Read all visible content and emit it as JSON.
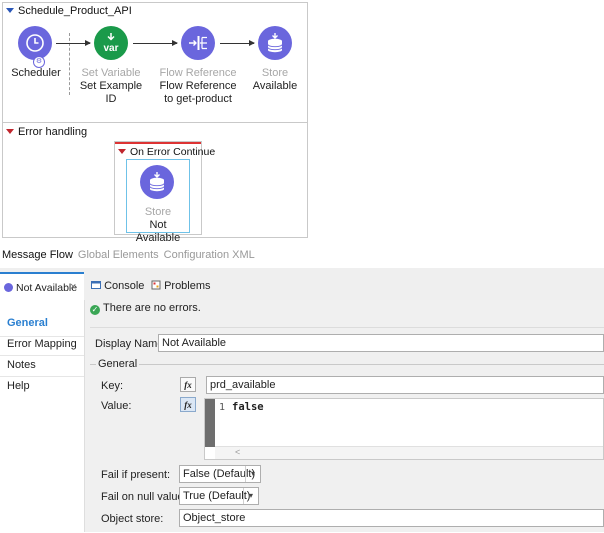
{
  "flow": {
    "name": "Schedule_Product_API",
    "nodes": [
      {
        "type": "",
        "label": "Scheduler"
      },
      {
        "type": "Set Variable",
        "label": "Set Example ID",
        "icon_text": "var"
      },
      {
        "type": "Flow Reference",
        "label": "Flow Reference to get-product"
      },
      {
        "type": "Store",
        "label": "Available"
      }
    ],
    "error_handling": {
      "title": "Error handling",
      "scope_title": "On Error Continue",
      "node": {
        "type": "Store",
        "label": "Not Available"
      }
    }
  },
  "canvas_tabs": [
    "Message Flow",
    "Global Elements",
    "Configuration XML"
  ],
  "editor_tab": {
    "label": "Not Available",
    "close": "×"
  },
  "console_tabs": [
    "Console",
    "Problems"
  ],
  "sidebar": [
    "General",
    "Error Mapping",
    "Notes",
    "Help"
  ],
  "status": {
    "text": "There are no errors."
  },
  "form": {
    "display_name_label": "Display Name:",
    "display_name_value": "Not Available",
    "group_label": "General",
    "key_label": "Key:",
    "key_value": "prd_available",
    "value_label": "Value:",
    "fx": "fx",
    "code_line_number": "1",
    "code_text": "false",
    "scroll_left": "<",
    "fail_if_present_label": "Fail if present:",
    "fail_if_present_value": "False (Default)",
    "fail_on_null_label": "Fail on null value:",
    "fail_on_null_value": "True (Default)",
    "object_store_label": "Object store:",
    "object_store_value": "Object_store"
  },
  "colors": {
    "node_purple": "#6a66dd",
    "node_green": "#1a9a4a",
    "accent_blue": "#2a7fd0",
    "error_red": "#d33333"
  }
}
